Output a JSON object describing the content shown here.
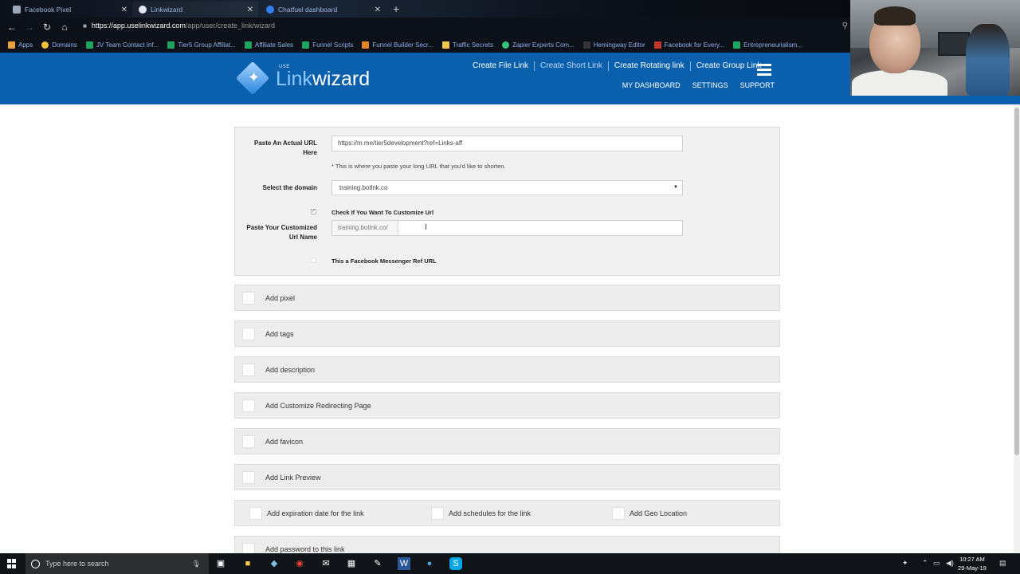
{
  "browser": {
    "tabs": [
      {
        "title": "Facebook Pixel",
        "icon": "document-icon"
      },
      {
        "title": "Linkwizard",
        "icon": "linkwizard-icon"
      },
      {
        "title": "Chatfuel dashboard",
        "icon": "chatfuel-icon"
      }
    ],
    "url_host": "https://app.uselinkwizard.com",
    "url_path": "/app/user/create_link/wizard",
    "bookmarks": [
      {
        "label": "Apps",
        "icon": "apps-grid-icon",
        "color": "#e8a33d"
      },
      {
        "label": "Domains",
        "icon": "pin-icon",
        "color": "#f0c23b"
      },
      {
        "label": "JV Team Contact Inf...",
        "icon": "sheets-icon",
        "color": "#1fa463"
      },
      {
        "label": "Tier5 Group Affiliat...",
        "icon": "sheets-icon",
        "color": "#1fa463"
      },
      {
        "label": "Affiliate Sales",
        "icon": "sheets-icon",
        "color": "#1fa463"
      },
      {
        "label": "Funnel Scripts",
        "icon": "sheets-icon",
        "color": "#1fa463"
      },
      {
        "label": "Funnel Builder Secr...",
        "icon": "funnel-icon",
        "color": "#e2852b"
      },
      {
        "label": "Traffic Secrets",
        "icon": "lock-icon",
        "color": "#f2c94c"
      },
      {
        "label": "Zapier Experts Com...",
        "icon": "zapier-icon",
        "color": "#34c27c"
      },
      {
        "label": "Hemingway Editor",
        "icon": "hemingway-icon",
        "color": "#333333"
      },
      {
        "label": "Facebook for Every...",
        "icon": "facebook-icon",
        "color": "#c0392b"
      },
      {
        "label": "Entrepreneurialism...",
        "icon": "sheets-icon",
        "color": "#1fa463"
      }
    ]
  },
  "app": {
    "logo_use": "USE",
    "logo_link": "Link",
    "logo_wizard": "wizard",
    "nav": [
      "Create File Link",
      "Create Short Link",
      "Create Rotating link",
      "Create Group Link"
    ],
    "subnav": [
      "MY DASHBOARD",
      "SETTINGS",
      "SUPPORT"
    ],
    "brand_color": "#0a60ad"
  },
  "form": {
    "url_label": "Paste An Actual URL Here",
    "url_value": "https://m.me/tier5development?ref=Links-aff",
    "url_hint": "* This is where you paste your long URL that you'd like to shorten.",
    "domain_label": "Select the domain",
    "domain_value": "training.botlnk.co",
    "customize_check_label": "Check If You Want To Customize Url",
    "custom_label": "Paste Your Customized Url Name",
    "custom_prefix": "training.botlnk.co/",
    "custom_value": "",
    "messenger_label": "This a Facebook Messenger Ref URL"
  },
  "accordions": [
    "Add pixel",
    "Add tags",
    "Add description",
    "Add Customize Redirecting Page",
    "Add favicon",
    "Add Link Preview"
  ],
  "options_row": [
    "Add expiration date for the link",
    "Add schedules for the link",
    "Add Geo Location"
  ],
  "partial_row": "Add password to this link",
  "taskbar": {
    "search_placeholder": "Type here to search",
    "time": "10:27 AM",
    "date": "29-May-19"
  }
}
